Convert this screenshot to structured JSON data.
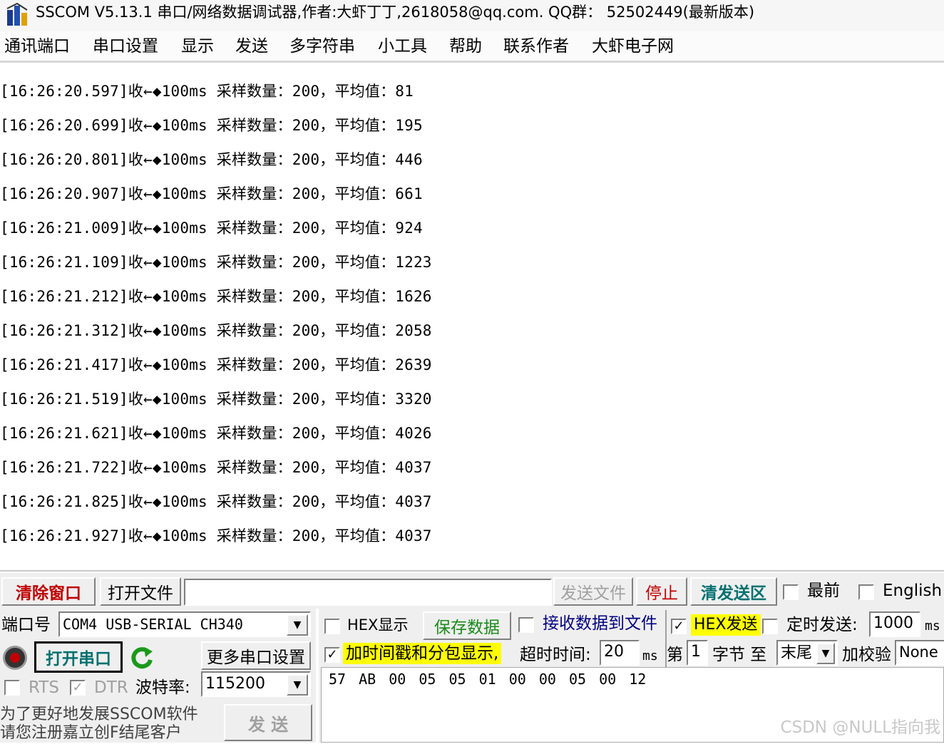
{
  "window": {
    "title": "SSCOM V5.13.1 串口/网络数据调试器,作者:大虾丁丁,2618058@qq.com. QQ群：  52502449(最新版本)"
  },
  "menu": [
    "通讯端口",
    "串口设置",
    "显示",
    "发送",
    "多字符串",
    "小工具",
    "帮助",
    "联系作者",
    "大虾电子网"
  ],
  "receive": {
    "lines": [
      "[16:26:20.597]收←◆100ms 采样数量：200，平均值：81",
      "[16:26:20.699]收←◆100ms 采样数量：200，平均值：195",
      "[16:26:20.801]收←◆100ms 采样数量：200，平均值：446",
      "[16:26:20.907]收←◆100ms 采样数量：200，平均值：661",
      "[16:26:21.009]收←◆100ms 采样数量：200，平均值：924",
      "[16:26:21.109]收←◆100ms 采样数量：200，平均值：1223",
      "[16:26:21.212]收←◆100ms 采样数量：200，平均值：1626",
      "[16:26:21.312]收←◆100ms 采样数量：200，平均值：2058",
      "[16:26:21.417]收←◆100ms 采样数量：200，平均值：2639",
      "[16:26:21.519]收←◆100ms 采样数量：200，平均值：3320",
      "[16:26:21.621]收←◆100ms 采样数量：200，平均值：4026",
      "[16:26:21.722]收←◆100ms 采样数量：200，平均值：4037",
      "[16:26:21.825]收←◆100ms 采样数量：200，平均值：4037",
      "[16:26:21.927]收←◆100ms 采样数量：200，平均值：4037"
    ]
  },
  "toolbar": {
    "clear_window": "清除窗口",
    "open_file": "打开文件",
    "file_path": "",
    "send_file": "发送文件",
    "stop": "停止",
    "clear_send": "清发送区",
    "topmost": "最前",
    "topmost_checked": false,
    "english": "English",
    "english_checked": false
  },
  "port": {
    "port_label": "端口号",
    "port_value": "COM4 USB-SERIAL CH340",
    "open_button": "打开串口",
    "more_settings": "更多串口设置",
    "rts": "RTS",
    "dtr": "DTR",
    "rts_checked": false,
    "dtr_checked": true,
    "baud_label": "波特率:",
    "baud_value": "115200"
  },
  "promo": {
    "line1": "为了更好地发展SSCOM软件",
    "line2": "请您注册嘉立创F结尾客户"
  },
  "send_button": "发  送",
  "options": {
    "hex_display": "HEX显示",
    "hex_display_checked": false,
    "save_data": "保存数据",
    "receive_to_file": "接收数据到文件",
    "receive_to_file_checked": false,
    "hex_send": "HEX发送",
    "hex_send_checked": true,
    "timed_send": "定时发送:",
    "timed_send_checked": false,
    "timed_value": "1000",
    "timed_unit": "ms",
    "timestamp": "加时间戳和分包显示,",
    "timestamp_checked": true,
    "timeout_label": "超时时间:",
    "timeout_value": "20",
    "timeout_unit": "ms",
    "byte_label_1": "第",
    "byte_value": "1",
    "byte_label_2": "字节 至",
    "end_value": "末尾",
    "checksum_label": "加校验",
    "checksum_value": "None"
  },
  "send_data": "57 AB 00 05 05 01 00 00 05 00 12",
  "watermark": "CSDN @NULL指向我",
  "colors": {
    "red_text": "#c00000",
    "teal_text": "#007070",
    "green_text": "#1a8a1a",
    "blue_text": "#000080",
    "highlight_yellow": "#ffff00",
    "disabled_text": "#a0a0a0"
  }
}
